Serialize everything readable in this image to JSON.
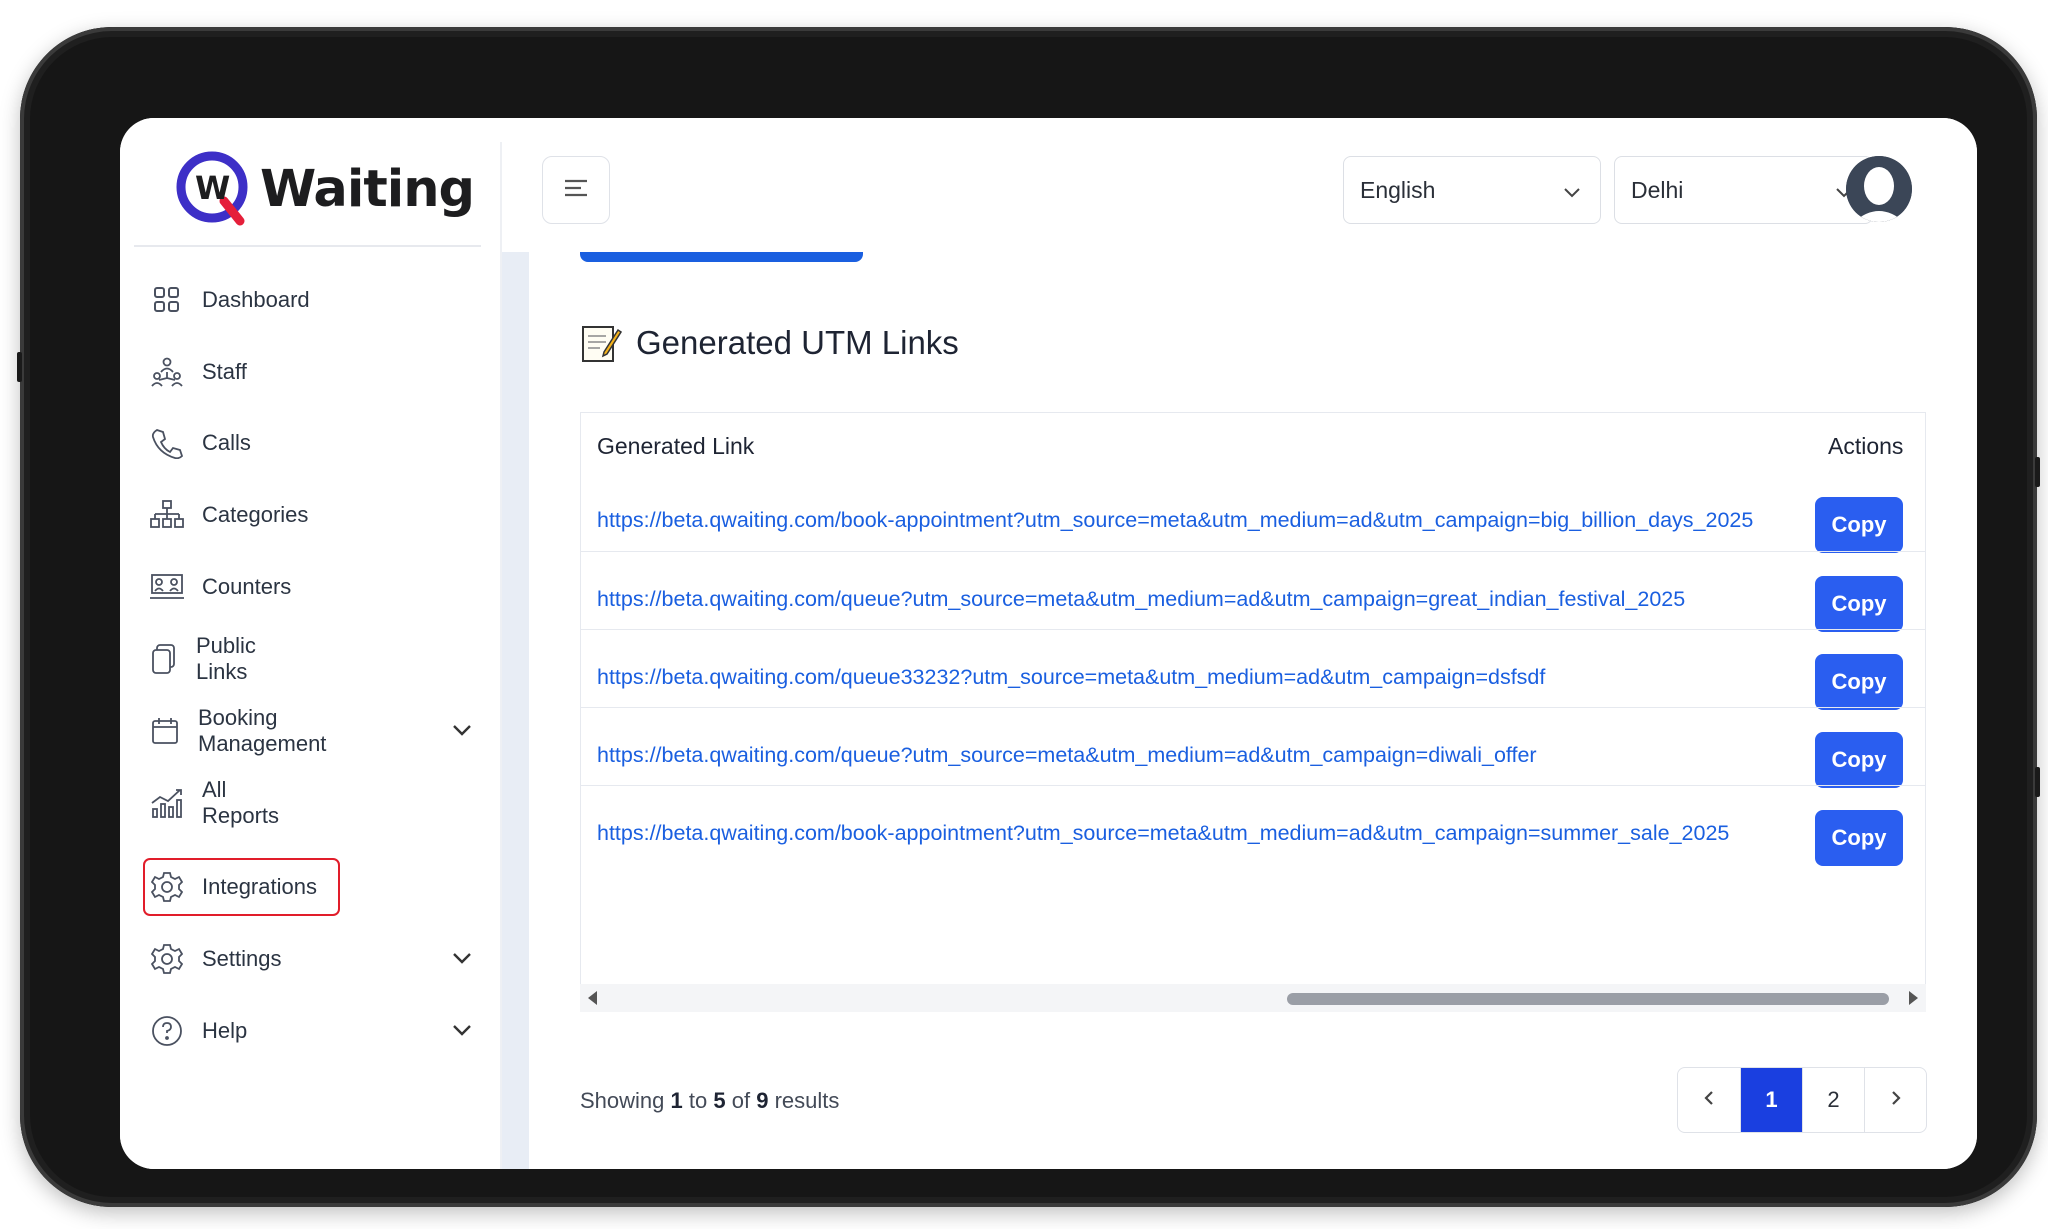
{
  "app": {
    "brand": "Waiting",
    "brand_mark": "W"
  },
  "sidebar": {
    "items": [
      {
        "label": "Dashboard",
        "icon": "grid-icon"
      },
      {
        "label": "Staff",
        "icon": "staff-icon"
      },
      {
        "label": "Calls",
        "icon": "phone-icon"
      },
      {
        "label": "Categories",
        "icon": "hierarchy-icon"
      },
      {
        "label": "Counters",
        "icon": "counter-icon"
      },
      {
        "label": "Public Links",
        "icon": "copy-link-icon"
      },
      {
        "label": "Booking Management",
        "icon": "calendar-icon"
      },
      {
        "label": "All Reports",
        "icon": "chart-icon"
      },
      {
        "label": "Integrations",
        "icon": "gear-icon"
      },
      {
        "label": "Settings",
        "icon": "gear-icon"
      },
      {
        "label": "Help",
        "icon": "help-icon"
      }
    ]
  },
  "header": {
    "language": "English",
    "location": "Delhi"
  },
  "card": {
    "title": "Generated UTM Links",
    "columns": {
      "link": "Generated Link",
      "actions": "Actions"
    },
    "rows": [
      {
        "link": "https://beta.qwaiting.com/book-appointment?utm_source=meta&utm_medium=ad&utm_campaign=big_billion_days_2025",
        "action": "Copy"
      },
      {
        "link": "https://beta.qwaiting.com/queue?utm_source=meta&utm_medium=ad&utm_campaign=great_indian_festival_2025",
        "action": "Copy"
      },
      {
        "link": "https://beta.qwaiting.com/queue33232?utm_source=meta&utm_medium=ad&utm_campaign=dsfsdf",
        "action": "Copy"
      },
      {
        "link": "https://beta.qwaiting.com/queue?utm_source=meta&utm_medium=ad&utm_campaign=diwali_offer",
        "action": "Copy"
      },
      {
        "link": "https://beta.qwaiting.com/book-appointment?utm_source=meta&utm_medium=ad&utm_campaign=summer_sale_2025",
        "action": "Copy"
      }
    ]
  },
  "pagination": {
    "showing": "Showing",
    "from": "1",
    "to_word": "to",
    "to": "5",
    "of_word": "of",
    "total": "9",
    "results_word": "results",
    "pages": [
      "1",
      "2"
    ],
    "current": "1"
  },
  "colors": {
    "accent": "#2a5ef0",
    "highlight": "#e11d2a",
    "link": "#1a5fe0"
  }
}
